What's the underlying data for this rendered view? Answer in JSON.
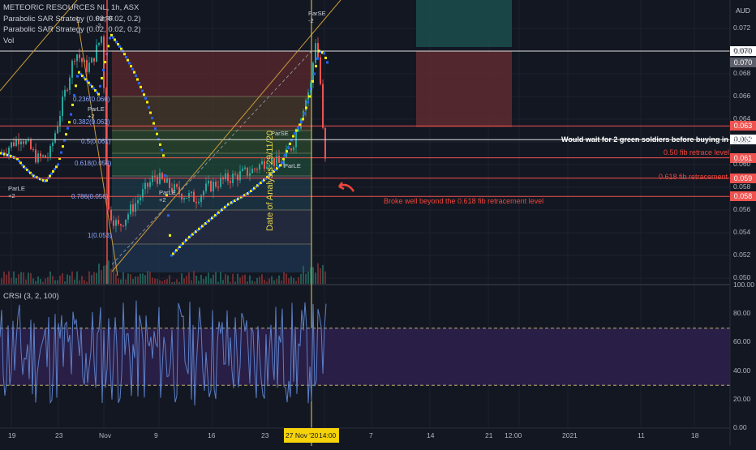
{
  "legend": {
    "symbol": "METEORIC RESOURCES NL, 1h, ASX",
    "study1": "Parabolic SAR Strategy (0.02, 0.02, 0.2)",
    "study2": "Parabolic SAR Strategy (0.02, 0.02, 0.2)",
    "vol": "Vol",
    "crsi": "CRSI (3, 2, 100)"
  },
  "currency": "AUD",
  "price_labels": [
    {
      "value": "0.070",
      "style": "white"
    },
    {
      "value": "0.070",
      "style": "gray"
    },
    {
      "value": "0.063",
      "style": "red"
    },
    {
      "value": "0.062",
      "style": "white"
    },
    {
      "value": "0.061",
      "style": "red"
    },
    {
      "value": "0.059",
      "style": "red"
    },
    {
      "value": "0.058",
      "style": "red"
    }
  ],
  "annotations": {
    "wait_note": "Would wait for 2 green soldiers before buying in at 0.062",
    "fib50_note": "0.50 fib retrace level",
    "fib618_note": "0.618 fib retracement",
    "broke_note": "Broke well beyond the 0.618 fib retracement level",
    "date_note": "Date of Analysis 29/11/20"
  },
  "sar_labels": [
    "ParLE +2",
    "ParLE +2",
    "ParLE +2",
    "ParLE",
    "ParSE",
    "ParSE -2",
    "ParSE -2"
  ],
  "colors": {
    "bg": "#131722",
    "up": "#26a69a",
    "down": "#ef5350",
    "sar_yellow": "#f5f10a",
    "sar_blue": "#2962ff",
    "crsi": "#5b7fc7",
    "annotation_red": "#f0453a",
    "vline": "#e8d54a"
  },
  "chart_data": {
    "type": "candlestick",
    "symbol": "METEORIC RESOURCES NL",
    "interval": "1h",
    "exchange": "ASX",
    "currency": "AUD",
    "y_range": [
      0.0495,
      0.0745
    ],
    "y_ticks": [
      "0.072",
      "0.070",
      "0.068",
      "0.066",
      "0.064",
      "0.062",
      "0.060",
      "0.058",
      "0.056",
      "0.054",
      "0.052",
      "0.050"
    ],
    "x_ticks": [
      "19",
      "23",
      "Nov",
      "9",
      "16",
      "23",
      "27 Nov '20",
      "14:00",
      "7",
      "14",
      "21",
      "12:00",
      "2021",
      "11",
      "18"
    ],
    "fib_levels": [
      {
        "ratio": "0.236",
        "value": "0.066"
      },
      {
        "ratio": "0.382",
        "value": "0.063"
      },
      {
        "ratio": "0.5",
        "value": "0.061"
      },
      {
        "ratio": "0.618",
        "value": "0.059"
      },
      {
        "ratio": "0.786",
        "value": "0.056"
      },
      {
        "ratio": "1",
        "value": "0.053"
      }
    ],
    "fib_labels": [
      "0.236(0.066)",
      "0.382(0.063)",
      "0.5(0.061)",
      "0.618(0.059)",
      "0.786(0.056)",
      "1(0.053)"
    ],
    "horizontal_levels": [
      0.07,
      0.0622,
      0.0605,
      0.0588
    ],
    "position_box": {
      "entry": 0.07,
      "target": 0.075,
      "stop": 0.0633
    },
    "crsi": {
      "range": [
        0,
        100
      ],
      "y_ticks": [
        "100.00",
        "80.00",
        "60.00",
        "40.00",
        "20.00",
        "0.00"
      ],
      "band": [
        30,
        70
      ]
    },
    "price_path": [
      [
        0,
        0.061
      ],
      [
        25,
        0.0625
      ],
      [
        45,
        0.0605
      ],
      [
        60,
        0.0608
      ],
      [
        78,
        0.066
      ],
      [
        92,
        0.07
      ],
      [
        105,
        0.0685
      ],
      [
        112,
        0.069
      ],
      [
        125,
        0.0715
      ],
      [
        132,
        0.056
      ],
      [
        145,
        0.0545
      ],
      [
        160,
        0.056
      ],
      [
        175,
        0.0575
      ],
      [
        190,
        0.059
      ],
      [
        205,
        0.0582
      ],
      [
        220,
        0.0575
      ],
      [
        240,
        0.057
      ],
      [
        255,
        0.058
      ],
      [
        270,
        0.0585
      ],
      [
        290,
        0.059
      ],
      [
        310,
        0.0595
      ],
      [
        330,
        0.0605
      ],
      [
        345,
        0.06
      ],
      [
        360,
        0.0618
      ],
      [
        372,
        0.065
      ],
      [
        382,
        0.067
      ],
      [
        388,
        0.071
      ],
      [
        393,
        0.0685
      ],
      [
        398,
        0.0615
      ],
      [
        402,
        0.059
      ]
    ],
    "sar_points": [
      [
        0,
        0.061
      ],
      [
        10,
        0.0608
      ],
      [
        20,
        0.0605
      ],
      [
        28,
        0.0598
      ],
      [
        40,
        0.059
      ],
      [
        55,
        0.0585
      ],
      [
        70,
        0.06
      ],
      [
        85,
        0.064
      ],
      [
        95,
        0.0682
      ],
      [
        108,
        0.0672
      ],
      [
        120,
        0.0662
      ],
      [
        135,
        0.0715
      ],
      [
        150,
        0.07
      ],
      [
        165,
        0.068
      ],
      [
        180,
        0.0655
      ],
      [
        195,
        0.062
      ],
      [
        200,
        0.0608
      ],
      [
        210,
        0.052
      ],
      [
        230,
        0.0535
      ],
      [
        255,
        0.055
      ],
      [
        280,
        0.0565
      ],
      [
        305,
        0.0575
      ],
      [
        330,
        0.059
      ],
      [
        345,
        0.06
      ],
      [
        360,
        0.0625
      ],
      [
        372,
        0.064
      ],
      [
        380,
        0.066
      ],
      [
        386,
        0.068
      ],
      [
        392,
        0.07
      ],
      [
        398,
        0.0698
      ],
      [
        402,
        0.069
      ]
    ]
  }
}
